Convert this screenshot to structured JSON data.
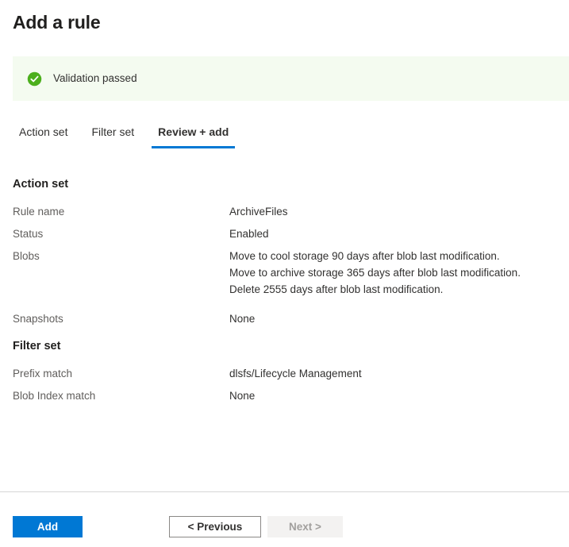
{
  "page": {
    "title": "Add a rule"
  },
  "banner": {
    "icon": "success-check-circle-icon",
    "message": "Validation passed",
    "background_color": "#f4fbf0",
    "icon_color": "#4caf1d"
  },
  "tabs": {
    "accent_color": "#0078d4",
    "items": [
      {
        "label": "Action set",
        "active": false
      },
      {
        "label": "Filter set",
        "active": false
      },
      {
        "label": "Review + add",
        "active": true
      }
    ]
  },
  "sections": [
    {
      "heading": "Action set",
      "rows": [
        {
          "key": "Rule name",
          "values": [
            "ArchiveFiles"
          ]
        },
        {
          "key": "Status",
          "values": [
            "Enabled"
          ]
        },
        {
          "key": "Blobs",
          "values": [
            "Move to cool storage 90 days after blob last modification.",
            "Move to archive storage 365 days after blob last modification.",
            "Delete 2555 days after blob last modification."
          ]
        },
        {
          "key": "Snapshots",
          "values": [
            "None"
          ]
        }
      ]
    },
    {
      "heading": "Filter set",
      "rows": [
        {
          "key": "Prefix match",
          "values": [
            "dlsfs/Lifecycle Management"
          ]
        },
        {
          "key": "Blob Index match",
          "values": [
            "None"
          ]
        }
      ]
    }
  ],
  "footer": {
    "add_label": "Add",
    "previous_label": "< Previous",
    "next_label": "Next >",
    "primary_color": "#0078d4"
  }
}
